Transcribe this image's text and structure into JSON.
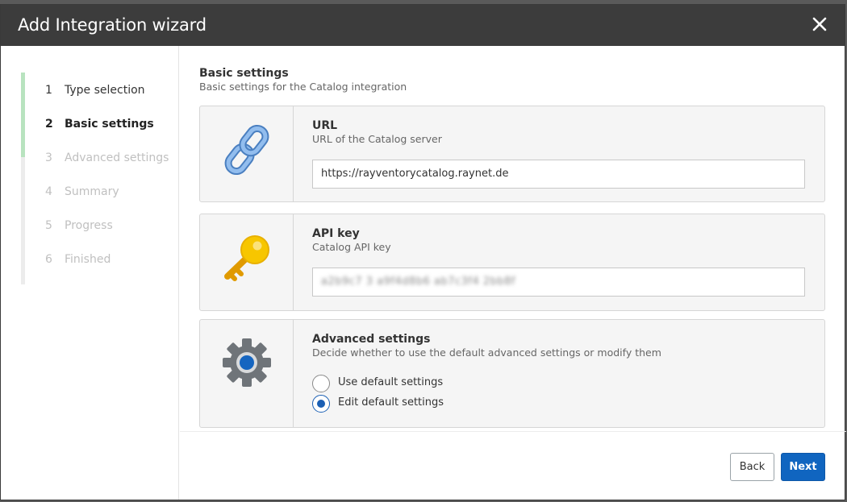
{
  "dialog": {
    "title": "Add Integration wizard",
    "close_icon": "close-icon"
  },
  "steps": [
    {
      "num": "1",
      "label": "Type selection",
      "state": "done"
    },
    {
      "num": "2",
      "label": "Basic settings",
      "state": "active"
    },
    {
      "num": "3",
      "label": "Advanced settings",
      "state": "pending"
    },
    {
      "num": "4",
      "label": "Summary",
      "state": "pending"
    },
    {
      "num": "5",
      "label": "Progress",
      "state": "pending"
    },
    {
      "num": "6",
      "label": "Finished",
      "state": "pending"
    }
  ],
  "progress": {
    "completed_fraction": 0.4
  },
  "section": {
    "title": "Basic settings",
    "subtitle": "Basic settings for the Catalog integration"
  },
  "url_card": {
    "icon": "chain-link-icon",
    "label": "URL",
    "description": "URL of the Catalog server",
    "value": "https://rayventorycatalog.raynet.de"
  },
  "api_card": {
    "icon": "key-icon",
    "label": "API key",
    "description": "Catalog API key",
    "value": "a2b9c7 3 a9f4d8b6 ab7c3f4 2bb8f"
  },
  "advanced_card": {
    "icon": "gear-icon",
    "label": "Advanced settings",
    "description": "Decide whether to use the default advanced settings or modify them",
    "options": [
      {
        "label": "Use default settings",
        "checked": false
      },
      {
        "label": "Edit default settings",
        "checked": true
      }
    ]
  },
  "buttons": {
    "back": "Back",
    "next": "Next"
  },
  "colors": {
    "title_bar": "#3c3c3c",
    "accent": "#1065c0",
    "progress": "#b8e3bf",
    "key": "#f5c400",
    "link": "#7fb0e6"
  }
}
